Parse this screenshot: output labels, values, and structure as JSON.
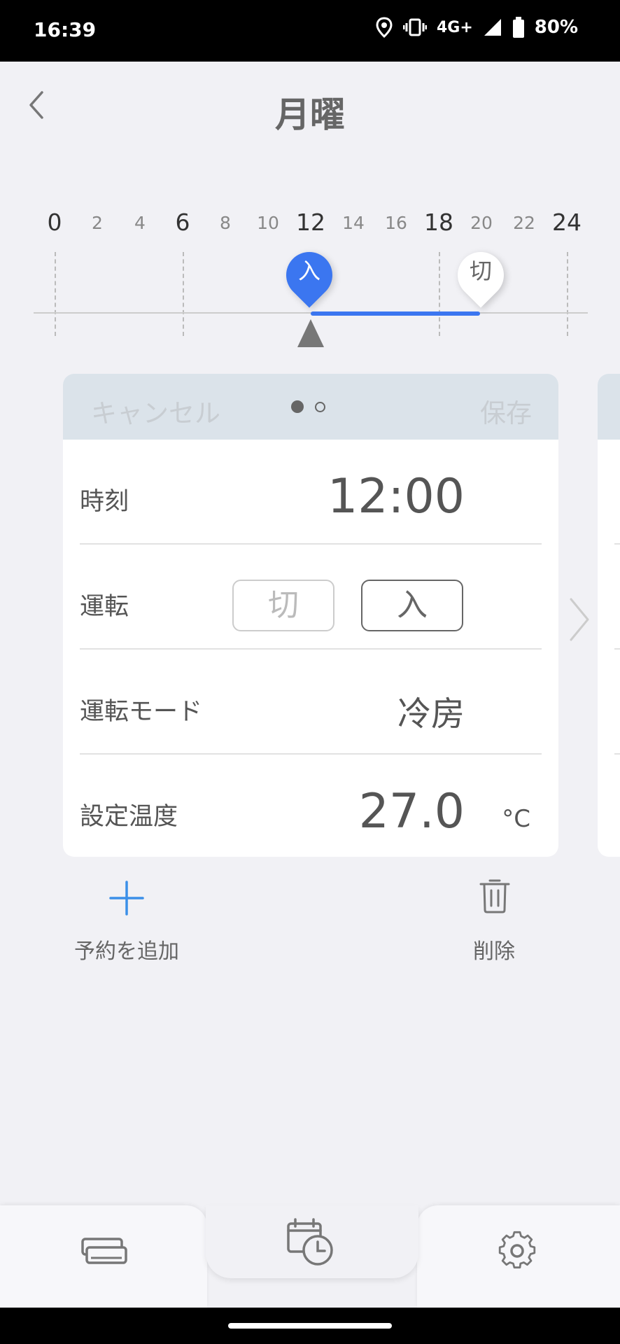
{
  "status": {
    "time": "16:39",
    "network": "4G+",
    "battery": "80%"
  },
  "header": {
    "title": "月曜"
  },
  "timeline": {
    "ticks": [
      "0",
      "2",
      "4",
      "6",
      "8",
      "10",
      "12",
      "14",
      "16",
      "18",
      "20",
      "22",
      "24"
    ],
    "on_pin": "入",
    "off_pin": "切",
    "on_hour": 12,
    "off_hour": 20,
    "accent": "#3b76f0"
  },
  "card": {
    "cancel": "キャンセル",
    "save": "保存",
    "rows": {
      "time_label": "時刻",
      "time_value": "12:00",
      "power_label": "運転",
      "power_off": "切",
      "power_on": "入",
      "mode_label": "運転モード",
      "mode_value": "冷房",
      "temp_label": "設定温度",
      "temp_value": "27.0",
      "temp_unit": "°C"
    }
  },
  "actions": {
    "add": "予約を追加",
    "delete": "削除"
  },
  "nav": {
    "icons": [
      "air-conditioner-icon",
      "schedule-clock-icon",
      "gear-icon"
    ]
  }
}
